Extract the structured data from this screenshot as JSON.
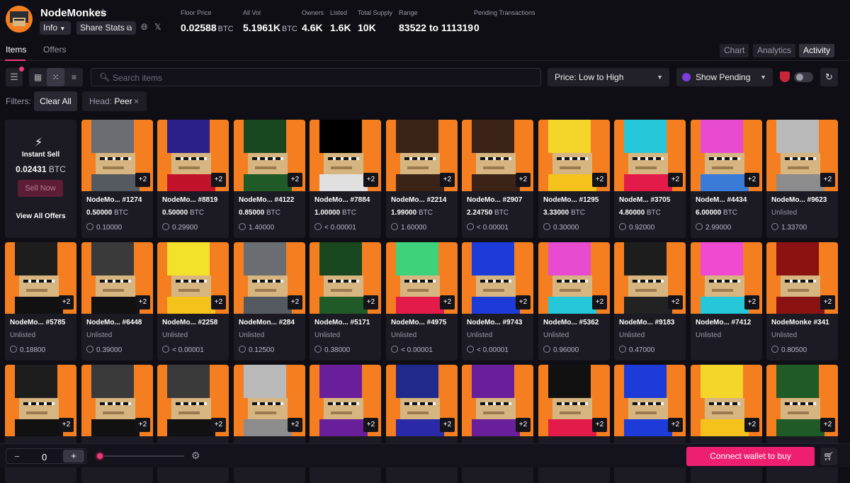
{
  "header": {
    "collection_name": "NodeMonkes",
    "star_icon": "star-outline-icon",
    "info_label": "Info",
    "share_label": "Share Stats",
    "stats": [
      {
        "label": "Floor Price",
        "value": "0.02588",
        "unit": "BTC"
      },
      {
        "label": "All Vol",
        "value": "5.1961K",
        "unit": "BTC"
      },
      {
        "label": "Owners",
        "value": "4.6K",
        "unit": ""
      },
      {
        "label": "Listed",
        "value": "1.6K",
        "unit": ""
      },
      {
        "label": "Total Supply",
        "value": "10K",
        "unit": ""
      },
      {
        "label": "Range",
        "value": "83522 to 111319",
        "unit": ""
      },
      {
        "label": "Pending Transactions",
        "value": "0",
        "unit": ""
      }
    ]
  },
  "tabs": {
    "items": "Items",
    "offers": "Offers"
  },
  "view_tabs": {
    "chart": "Chart",
    "analytics": "Analytics",
    "activity": "Activity"
  },
  "toolbar": {
    "search_placeholder": "Search items",
    "sort_value": "Price: Low to High",
    "pending_value": "Show Pending"
  },
  "filters": {
    "label": "Filters:",
    "clear_label": "Clear All",
    "chip_key": "Head:",
    "chip_value": "Peer"
  },
  "instant_sell": {
    "title": "Instant Sell",
    "price": "0.02431",
    "unit": "BTC",
    "sell_label": "Sell Now",
    "view_offers_label": "View All Offers"
  },
  "colors": {
    "accent": "#ef1f6f",
    "background": "#0f0e15",
    "card": "#1c1b23",
    "art_orange": "#f57f20"
  },
  "cards": [
    {
      "name": "NodeMo... #1274",
      "price": "0.50000",
      "unit": "BTC",
      "last": "0.10000",
      "plus": "+2",
      "hat": "#6a6d72",
      "body": "#555a60"
    },
    {
      "name": "NodeMo... #8819",
      "price": "0.50000",
      "unit": "BTC",
      "last": "0.29900",
      "plus": "+2",
      "hat": "#2b1f8a",
      "body": "#c2122a"
    },
    {
      "name": "NodeMo... #4122",
      "price": "0.85000",
      "unit": "BTC",
      "last": "1.40000",
      "plus": "+2",
      "hat": "#19471f",
      "body": "#1f5a27"
    },
    {
      "name": "NodeMo... #7884",
      "price": "1.00000",
      "unit": "BTC",
      "last": "< 0.00001",
      "plus": "+2",
      "hat": "#000000",
      "body": "#e0e0e0"
    },
    {
      "name": "NodeMo... #2214",
      "price": "1.99000",
      "unit": "BTC",
      "last": "1.60000",
      "plus": "+2",
      "hat": "#3b2318",
      "body": "#3b2318"
    },
    {
      "name": "NodeMo... #2907",
      "price": "2.24750",
      "unit": "BTC",
      "last": "< 0.00001",
      "plus": "+2",
      "hat": "#3b2318",
      "body": "#3b2318"
    },
    {
      "name": "NodeMo... #1295",
      "price": "3.33000",
      "unit": "BTC",
      "last": "0.30000",
      "plus": "+2",
      "hat": "#f4d52a",
      "body": "#f4c21a"
    },
    {
      "name": "NodeM... #3705",
      "price": "4.80000",
      "unit": "BTC",
      "last": "0.92000",
      "plus": "+2",
      "hat": "#25c7d8",
      "body": "#e21b4a"
    },
    {
      "name": "NodeM... #4434",
      "price": "6.00000",
      "unit": "BTC",
      "last": "2.99000",
      "plus": "+2",
      "hat": "#e84bd0",
      "body": "#3a7bd8"
    },
    {
      "name": "NodeMo... #9623",
      "price": "Unlisted",
      "unit": "",
      "last": "1.33700",
      "plus": "+2",
      "hat": "#b9b9b9",
      "body": "#8c8c8c"
    },
    {
      "name": "NodeMo... #5785",
      "price": "Unlisted",
      "unit": "",
      "last": "0.18800",
      "plus": "+2",
      "hat": "#1d1d1d",
      "body": "#111111"
    },
    {
      "name": "NodeMo... #6448",
      "price": "Unlisted",
      "unit": "",
      "last": "0.39000",
      "plus": "+2",
      "hat": "#3a3a3a",
      "body": "#111111"
    },
    {
      "name": "NodeMo... #2258",
      "price": "Unlisted",
      "unit": "",
      "last": "< 0.00001",
      "plus": "+2",
      "hat": "#f4e22a",
      "body": "#f4c21a"
    },
    {
      "name": "NodeMon... #284",
      "price": "Unlisted",
      "unit": "",
      "last": "0.12500",
      "plus": "+2",
      "hat": "#6a6d72",
      "body": "#555a60"
    },
    {
      "name": "NodeMo... #5171",
      "price": "Unlisted",
      "unit": "",
      "last": "0.38000",
      "plus": "+2",
      "hat": "#19471f",
      "body": "#1f5a27"
    },
    {
      "name": "NodeMo... #4975",
      "price": "Unlisted",
      "unit": "",
      "last": "< 0.00001",
      "plus": "+2",
      "hat": "#3ed27a",
      "body": "#e21b4a"
    },
    {
      "name": "NodeMo... #9743",
      "price": "Unlisted",
      "unit": "",
      "last": "< 0.00001",
      "plus": "+2",
      "hat": "#1c3bd8",
      "body": "#1c3bd8"
    },
    {
      "name": "NodeMo... #5362",
      "price": "Unlisted",
      "unit": "",
      "last": "0.96000",
      "plus": "+2",
      "hat": "#e84bd0",
      "body": "#25c7d8"
    },
    {
      "name": "NodeMo... #9183",
      "price": "Unlisted",
      "unit": "",
      "last": "0.47000",
      "plus": "+2",
      "hat": "#1d1d1d",
      "body": "#222222"
    },
    {
      "name": "NodeMo... #7412",
      "price": "Unlisted",
      "unit": "",
      "last": "",
      "plus": "+2",
      "hat": "#f04bd0",
      "body": "#25c7d8"
    },
    {
      "name": "NodeMonke #341",
      "price": "Unlisted",
      "unit": "",
      "last": "0.80500",
      "plus": "+2",
      "hat": "#8a1212",
      "body": "#8a1212"
    },
    {
      "name": "",
      "price": "",
      "unit": "",
      "last": "",
      "plus": "+2",
      "hat": "#1d1d1d",
      "body": "#111111"
    },
    {
      "name": "",
      "price": "",
      "unit": "",
      "last": "",
      "plus": "+2",
      "hat": "#3a3a3a",
      "body": "#111111"
    },
    {
      "name": "",
      "price": "",
      "unit": "",
      "last": "",
      "plus": "+2",
      "hat": "#3a3a3a",
      "body": "#111111"
    },
    {
      "name": "",
      "price": "",
      "unit": "",
      "last": "",
      "plus": "+2",
      "hat": "#b9b9b9",
      "body": "#8c8c8c"
    },
    {
      "name": "",
      "price": "",
      "unit": "",
      "last": "",
      "plus": "+2",
      "hat": "#6a1f9a",
      "body": "#6a1f9a"
    },
    {
      "name": "",
      "price": "",
      "unit": "",
      "last": "",
      "plus": "+2",
      "hat": "#1f2a8a",
      "body": "#2a2aa8"
    },
    {
      "name": "",
      "price": "",
      "unit": "",
      "last": "",
      "plus": "+2",
      "hat": "#6a1f9a",
      "body": "#6a1f9a"
    },
    {
      "name": "",
      "price": "",
      "unit": "",
      "last": "",
      "plus": "+2",
      "hat": "#111111",
      "body": "#e21b4a"
    },
    {
      "name": "",
      "price": "",
      "unit": "",
      "last": "",
      "plus": "+2",
      "hat": "#1c3bd8",
      "body": "#1c3bd8"
    },
    {
      "name": "",
      "price": "",
      "unit": "",
      "last": "",
      "plus": "+2",
      "hat": "#f4d52a",
      "body": "#f4c21a"
    },
    {
      "name": "",
      "price": "",
      "unit": "",
      "last": "",
      "plus": "+2",
      "hat": "#1f5a27",
      "body": "#1f5a27"
    }
  ],
  "bottom": {
    "quantity": "0",
    "minus": "−",
    "plus": "+",
    "connect_label": "Connect wallet to buy"
  }
}
